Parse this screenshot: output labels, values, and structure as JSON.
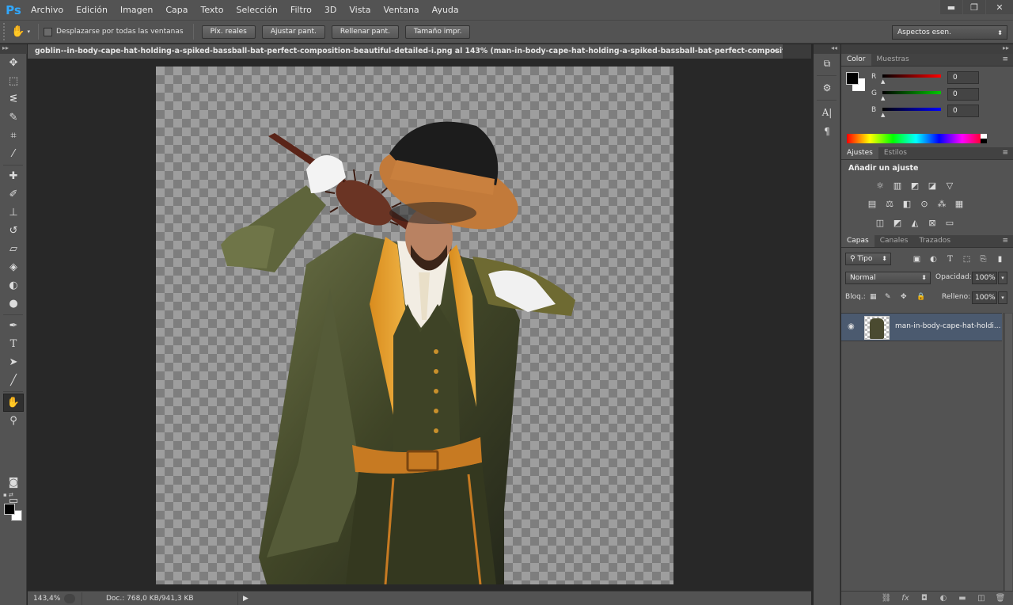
{
  "app": {
    "logo": "Ps",
    "menu": [
      "Archivo",
      "Edición",
      "Imagen",
      "Capa",
      "Texto",
      "Selección",
      "Filtro",
      "3D",
      "Vista",
      "Ventana",
      "Ayuda"
    ],
    "window_controls": {
      "minimize": "▬",
      "restore": "❐",
      "close": "✕"
    }
  },
  "options_bar": {
    "tool_icon": "hand-icon",
    "scroll_all_label": "Desplazarse por todas las ventanas",
    "buttons": [
      "Píx. reales",
      "Ajustar pant.",
      "Rellenar pant.",
      "Tamaño impr."
    ],
    "workspace": "Aspectos esen."
  },
  "document": {
    "tab_title": "goblin--in-body-cape-hat-holding-a-spiked-bassball-bat-perfect-composition-beautiful-detailed-i.png al 143% (man-in-body-cape-hat-holding-a-spiked-bassball-bat-perfect-composition-beautiful-de...",
    "close": "×"
  },
  "status": {
    "zoom": "143,4%",
    "doc_info": "Doc.: 768,0 KB/941,3 KB",
    "arrow": "▶"
  },
  "color_panel": {
    "tabs": [
      "Color",
      "Muestras"
    ],
    "channels": [
      {
        "label": "R",
        "value": "0",
        "color": "#ff0000"
      },
      {
        "label": "G",
        "value": "0",
        "color": "#00c800"
      },
      {
        "label": "B",
        "value": "0",
        "color": "#0000ff"
      }
    ]
  },
  "adjustments_panel": {
    "tabs": [
      "Ajustes",
      "Estilos"
    ],
    "title": "Añadir un ajuste"
  },
  "layers_panel": {
    "tabs": [
      "Capas",
      "Canales",
      "Trazados"
    ],
    "filter": "Tipo",
    "blend_mode": "Normal",
    "opacity_label": "Opacidad:",
    "opacity": "100%",
    "lock_label": "Bloq.:",
    "fill_label": "Relleno:",
    "fill": "100%",
    "layers": [
      {
        "name": "man-in-body-cape-hat-holdi...",
        "visible": true,
        "selected": true
      }
    ]
  },
  "colors": {
    "ui_bg": "#535353",
    "dark_bg": "#282828",
    "selected_layer": "#4b5a6f",
    "ps_blue": "#31a8ff"
  }
}
